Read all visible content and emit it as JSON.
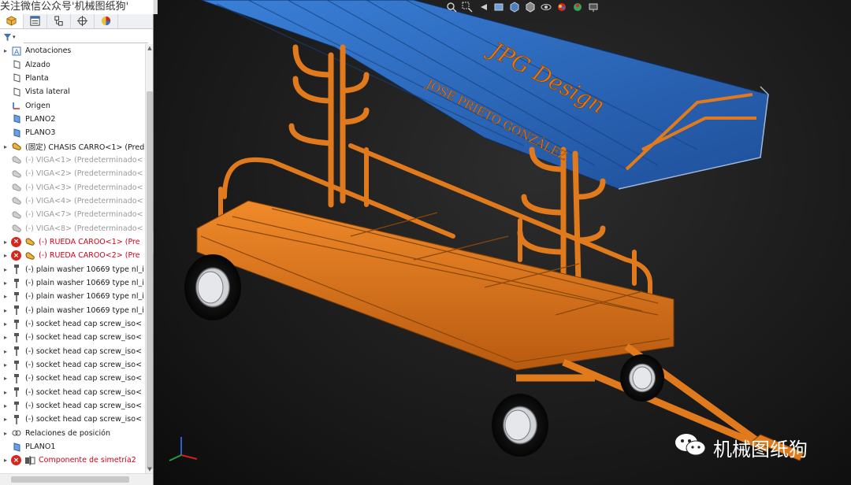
{
  "watermark_top": "关注微信公众号'机械图纸狗'",
  "left_panel": {
    "tabs": [
      {
        "icon": "feature-manager-icon"
      },
      {
        "icon": "property-manager-icon"
      },
      {
        "icon": "configuration-manager-icon"
      },
      {
        "icon": "dimxpert-manager-icon"
      },
      {
        "icon": "display-manager-icon"
      }
    ],
    "filter_icon": "filter-icon",
    "tree": [
      {
        "label": "Anotaciones",
        "icon": "annotations-icon",
        "expander": "▸",
        "state": "normal"
      },
      {
        "label": "Alzado",
        "icon": "plane-icon",
        "expander": "",
        "state": "normal"
      },
      {
        "label": "Planta",
        "icon": "plane-icon",
        "expander": "",
        "state": "normal"
      },
      {
        "label": "Vista lateral",
        "icon": "plane-icon",
        "expander": "",
        "state": "normal"
      },
      {
        "label": "Origen",
        "icon": "origin-icon",
        "expander": "",
        "state": "normal"
      },
      {
        "label": "PLANO2",
        "icon": "plane-blue-icon",
        "expander": "",
        "state": "normal"
      },
      {
        "label": "PLANO3",
        "icon": "plane-blue-icon",
        "expander": "",
        "state": "normal"
      },
      {
        "label": "(固定) CHASIS CARRO<1> (Pred",
        "icon": "part-icon",
        "expander": "▸",
        "state": "normal"
      },
      {
        "label": "(-) VIGA<1> (Predeterminado<",
        "icon": "part-gray-icon",
        "expander": "",
        "state": "suppressed"
      },
      {
        "label": "(-) VIGA<2> (Predeterminado<",
        "icon": "part-gray-icon",
        "expander": "",
        "state": "suppressed"
      },
      {
        "label": "(-) VIGA<3> (Predeterminado<",
        "icon": "part-gray-icon",
        "expander": "",
        "state": "suppressed"
      },
      {
        "label": "(-) VIGA<4> (Predeterminado<",
        "icon": "part-gray-icon",
        "expander": "",
        "state": "suppressed"
      },
      {
        "label": "(-) VIGA<7> (Predeterminado<",
        "icon": "part-gray-icon",
        "expander": "",
        "state": "suppressed"
      },
      {
        "label": "(-) VIGA<8> (Predeterminado<",
        "icon": "part-gray-icon",
        "expander": "",
        "state": "suppressed"
      },
      {
        "label": "(-) RUEDA CAROO<1> (Pre",
        "icon": "part-icon",
        "expander": "▸",
        "state": "error"
      },
      {
        "label": "(-) RUEDA CAROO<2> (Pre",
        "icon": "part-icon",
        "expander": "▸",
        "state": "error"
      },
      {
        "label": "(-) plain washer 10669 type nl_i",
        "icon": "screw-icon",
        "expander": "▸",
        "state": "normal"
      },
      {
        "label": "(-) plain washer 10669 type nl_i",
        "icon": "screw-icon",
        "expander": "▸",
        "state": "normal"
      },
      {
        "label": "(-) plain washer 10669 type nl_i",
        "icon": "screw-icon",
        "expander": "▸",
        "state": "normal"
      },
      {
        "label": "(-) plain washer 10669 type nl_i",
        "icon": "screw-icon",
        "expander": "▸",
        "state": "normal"
      },
      {
        "label": "(-) socket head cap screw_iso<",
        "icon": "screw-icon",
        "expander": "▸",
        "state": "normal"
      },
      {
        "label": "(-) socket head cap screw_iso<",
        "icon": "screw-icon",
        "expander": "▸",
        "state": "normal"
      },
      {
        "label": "(-) socket head cap screw_iso<",
        "icon": "screw-icon",
        "expander": "▸",
        "state": "normal"
      },
      {
        "label": "(-) socket head cap screw_iso<",
        "icon": "screw-icon",
        "expander": "▸",
        "state": "normal"
      },
      {
        "label": "(-) socket head cap screw_iso<",
        "icon": "screw-icon",
        "expander": "▸",
        "state": "normal"
      },
      {
        "label": "(-) socket head cap screw_iso<",
        "icon": "screw-icon",
        "expander": "▸",
        "state": "normal"
      },
      {
        "label": "(-) socket head cap screw_iso<",
        "icon": "screw-icon",
        "expander": "▸",
        "state": "normal"
      },
      {
        "label": "(-) socket head cap screw_iso<",
        "icon": "screw-icon",
        "expander": "▸",
        "state": "normal"
      },
      {
        "label": "Relaciones de posición",
        "icon": "mates-icon",
        "expander": "▸",
        "state": "normal"
      },
      {
        "label": "PLANO1",
        "icon": "plane-blue-icon",
        "expander": "",
        "state": "normal"
      },
      {
        "label": "Componente de simetría2",
        "icon": "mirror-icon",
        "expander": "▸",
        "state": "error"
      }
    ]
  },
  "viewport": {
    "model_text_1": "JPG Design",
    "model_text_2": "JOSE PRIETO GONZÁLEZ",
    "hud_icons": [
      "zoom-to-fit-icon",
      "zoom-area-icon",
      "previous-view-icon",
      "section-view-icon",
      "view-orientation-icon",
      "display-style-icon",
      "hide-show-icon",
      "edit-appearance-icon",
      "apply-scene-icon",
      "view-settings-icon"
    ],
    "watermark": "机械图纸狗",
    "colors": {
      "frame": "#e07a1c",
      "roof": "#2f6fc4",
      "lettering": "#e07a1c"
    }
  }
}
